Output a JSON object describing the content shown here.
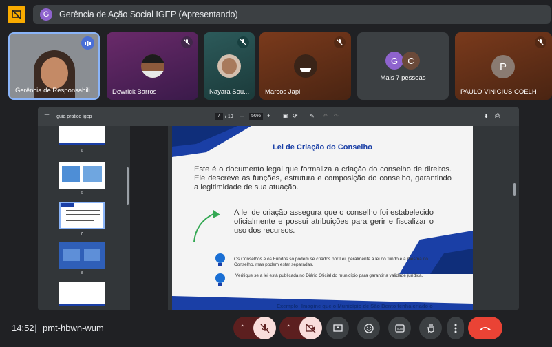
{
  "meeting": {
    "title": "Gerência de Ação Social IGEP (Apresentando)",
    "title_avatar_letter": "G",
    "time": "14:52",
    "code": "pmt-hbwn-wum"
  },
  "participants": [
    {
      "name": "Gerência de Responsabili...",
      "speaking": true
    },
    {
      "name": "Dewrick Barros",
      "muted": true
    },
    {
      "name": "Nayara Sou...",
      "muted": true
    },
    {
      "name": "Marcos Japi",
      "muted": true
    },
    {
      "name": "Mais 7 pessoas",
      "letters": [
        "G",
        "C"
      ]
    },
    {
      "name": "PAULO VINICIUS COELHO...",
      "letter": "P",
      "muted": true
    }
  ],
  "pdf": {
    "filename": "guia pratico igep",
    "page_current": "7",
    "page_total": "/ 19",
    "zoom": "50%",
    "thumb_numbers": [
      "5",
      "6",
      "7",
      "8"
    ]
  },
  "slide": {
    "heading": "Lei de Criação do Conselho",
    "intro": "Este é o documento legal que formaliza a criação do conselho de direitos. Ele descreve as funções, estrutura e composição do conselho, garantindo a legitimidade de sua atuação.",
    "highlight": "A lei de criação assegura que o conselho foi estabelecido oficialmente e possui atribuições para gerir e fiscalizar o uso dos recursos.",
    "tip1": "Os Conselhos e os Fundos só podem se criados por Lei, geralmente a lei do fundo é a mesma do Conselho, mas podem estar separadas.",
    "tip2": "Verifique se a lei está publicada no Diário Oficial do município para garantir a validade jurídica.",
    "next_page_text": "Exemplo: Imagine que o Município de São Bento tenha criado o"
  },
  "colors": {
    "accent_blue": "#1a3fa6",
    "red_end": "#ea4335",
    "muted_red": "#5c1f1f",
    "off_red": "#f9dedc"
  }
}
